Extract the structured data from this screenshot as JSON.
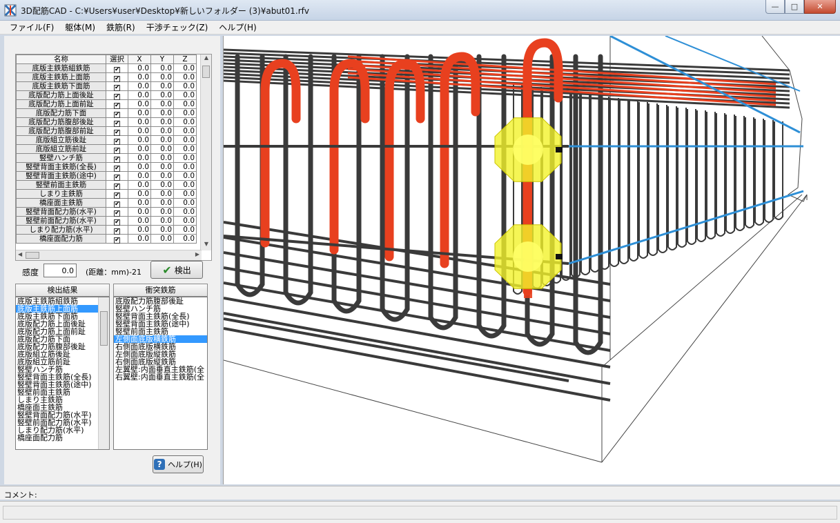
{
  "window": {
    "title": "3D配筋CAD - C:¥Users¥user¥Desktop¥新しいフォルダー (3)¥abut01.rfv",
    "minimize": "—",
    "maximize": "□",
    "close": "✕"
  },
  "menu": [
    {
      "label": "ファイル(F)"
    },
    {
      "label": "躯体(M)"
    },
    {
      "label": "鉄筋(R)"
    },
    {
      "label": "干渉チェック(Z)"
    },
    {
      "label": "ヘルプ(H)"
    }
  ],
  "grid": {
    "headers": {
      "name": "名称",
      "sel": "選択",
      "x": "X",
      "y": "Y",
      "z": "Z"
    },
    "rows": [
      {
        "name": "底版主鉄筋組鉄筋",
        "x": "0.0",
        "y": "0.0",
        "z": "0.0"
      },
      {
        "name": "底版主鉄筋上面筋",
        "x": "0.0",
        "y": "0.0",
        "z": "0.0"
      },
      {
        "name": "底版主鉄筋下面筋",
        "x": "0.0",
        "y": "0.0",
        "z": "0.0"
      },
      {
        "name": "底版配力筋上面後趾",
        "x": "0.0",
        "y": "0.0",
        "z": "0.0"
      },
      {
        "name": "底版配力筋上面前趾",
        "x": "0.0",
        "y": "0.0",
        "z": "0.0"
      },
      {
        "name": "底版配力筋下面",
        "x": "0.0",
        "y": "0.0",
        "z": "0.0"
      },
      {
        "name": "底版配力筋腹部後趾",
        "x": "0.0",
        "y": "0.0",
        "z": "0.0"
      },
      {
        "name": "底版配力筋腹部前趾",
        "x": "0.0",
        "y": "0.0",
        "z": "0.0"
      },
      {
        "name": "底版組立筋後趾",
        "x": "0.0",
        "y": "0.0",
        "z": "0.0"
      },
      {
        "name": "底版組立筋前趾",
        "x": "0.0",
        "y": "0.0",
        "z": "0.0"
      },
      {
        "name": "竪壁ハンチ筋",
        "x": "0.0",
        "y": "0.0",
        "z": "0.0"
      },
      {
        "name": "竪壁背面主鉄筋(全長)",
        "x": "0.0",
        "y": "0.0",
        "z": "0.0"
      },
      {
        "name": "竪壁背面主鉄筋(途中)",
        "x": "0.0",
        "y": "0.0",
        "z": "0.0"
      },
      {
        "name": "竪壁前面主鉄筋",
        "x": "0.0",
        "y": "0.0",
        "z": "0.0"
      },
      {
        "name": "しまり主鉄筋",
        "x": "0.0",
        "y": "0.0",
        "z": "0.0"
      },
      {
        "name": "橋座面主鉄筋",
        "x": "0.0",
        "y": "0.0",
        "z": "0.0"
      },
      {
        "name": "竪壁背面配力筋(水平)",
        "x": "0.0",
        "y": "0.0",
        "z": "0.0"
      },
      {
        "name": "竪壁前面配力筋(水平)",
        "x": "0.0",
        "y": "0.0",
        "z": "0.0"
      },
      {
        "name": "しまり配力筋(水平)",
        "x": "0.0",
        "y": "0.0",
        "z": "0.0"
      },
      {
        "name": "橋座面配力筋",
        "x": "0.0",
        "y": "0.0",
        "z": "0.0"
      }
    ]
  },
  "sensitivity": {
    "label": "感度",
    "value": "0.0",
    "distance_label": "(距離：mm)-21"
  },
  "detect_button": "検出",
  "results": {
    "header": "検出結果",
    "items": [
      "底版主鉄筋組鉄筋",
      "底版主鉄筋上面筋",
      "底版主鉄筋下面筋",
      "底版配力筋上面後趾",
      "底版配力筋上面前趾",
      "底版配力筋下面",
      "底版配力筋腹部後趾",
      "底版組立筋後趾",
      "底版組立筋前趾",
      "竪壁ハンチ筋",
      "竪壁背面主鉄筋(全長)",
      "竪壁背面主鉄筋(途中)",
      "竪壁前面主鉄筋",
      "しまり主鉄筋",
      "橋座面主鉄筋",
      "竪壁背面配力筋(水平)",
      "竪壁前面配力筋(水平)",
      "しまり配力筋(水平)",
      "橋座面配力筋"
    ],
    "selected_index": 1
  },
  "collisions": {
    "header": "衝突鉄筋",
    "items": [
      "底版配力筋腹部後趾",
      "竪壁ハンチ筋",
      "竪壁背面主鉄筋(全長)",
      "竪壁背面主鉄筋(途中)",
      "竪壁前面主鉄筋",
      "左側面底版横鉄筋",
      "右側面底版横鉄筋",
      "左側面底版縦鉄筋",
      "右側面底版縦鉄筋",
      "左翼壁:内面垂直主鉄筋(全",
      "右翼壁:内面垂直主鉄筋(全"
    ],
    "selected_index": 5
  },
  "help_button": "ヘルプ(H)",
  "comment_label": "コメント:",
  "colors": {
    "accent_red": "#e8401f",
    "accent_blue": "#2e8fd6",
    "rebar_gray": "#3a3a3a",
    "highlight_yellow": "#f3f22a",
    "selection": "#3399ff"
  }
}
